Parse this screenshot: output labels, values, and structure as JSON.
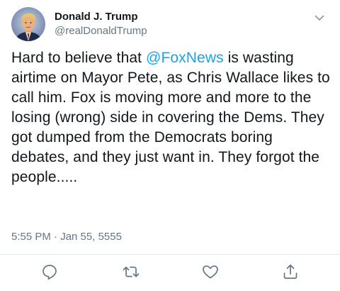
{
  "user": {
    "display_name": "Donald J. Trump",
    "handle": "@realDonaldTrump",
    "avatar_icon": "profile-photo-icon"
  },
  "tweet": {
    "text_before": "Hard to believe that ",
    "mention": "@FoxNews",
    "text_after": " is wasting airtime on Mayor Pete, as Chris Wallace likes to call him. Fox is moving more and more to the losing (wrong) side in covering the Dems. They got dumped from the Democrats boring debates, and they just want in. They forgot the people.....",
    "timestamp": "5:55 PM · Jan 55, 5555"
  },
  "actions": [
    {
      "icon": "reply-icon"
    },
    {
      "icon": "retweet-icon"
    },
    {
      "icon": "like-icon"
    },
    {
      "icon": "share-icon"
    }
  ],
  "colors": {
    "text": "#14171a",
    "secondary": "#657786",
    "link": "#1da1f2",
    "divider": "#e6ecf0"
  }
}
